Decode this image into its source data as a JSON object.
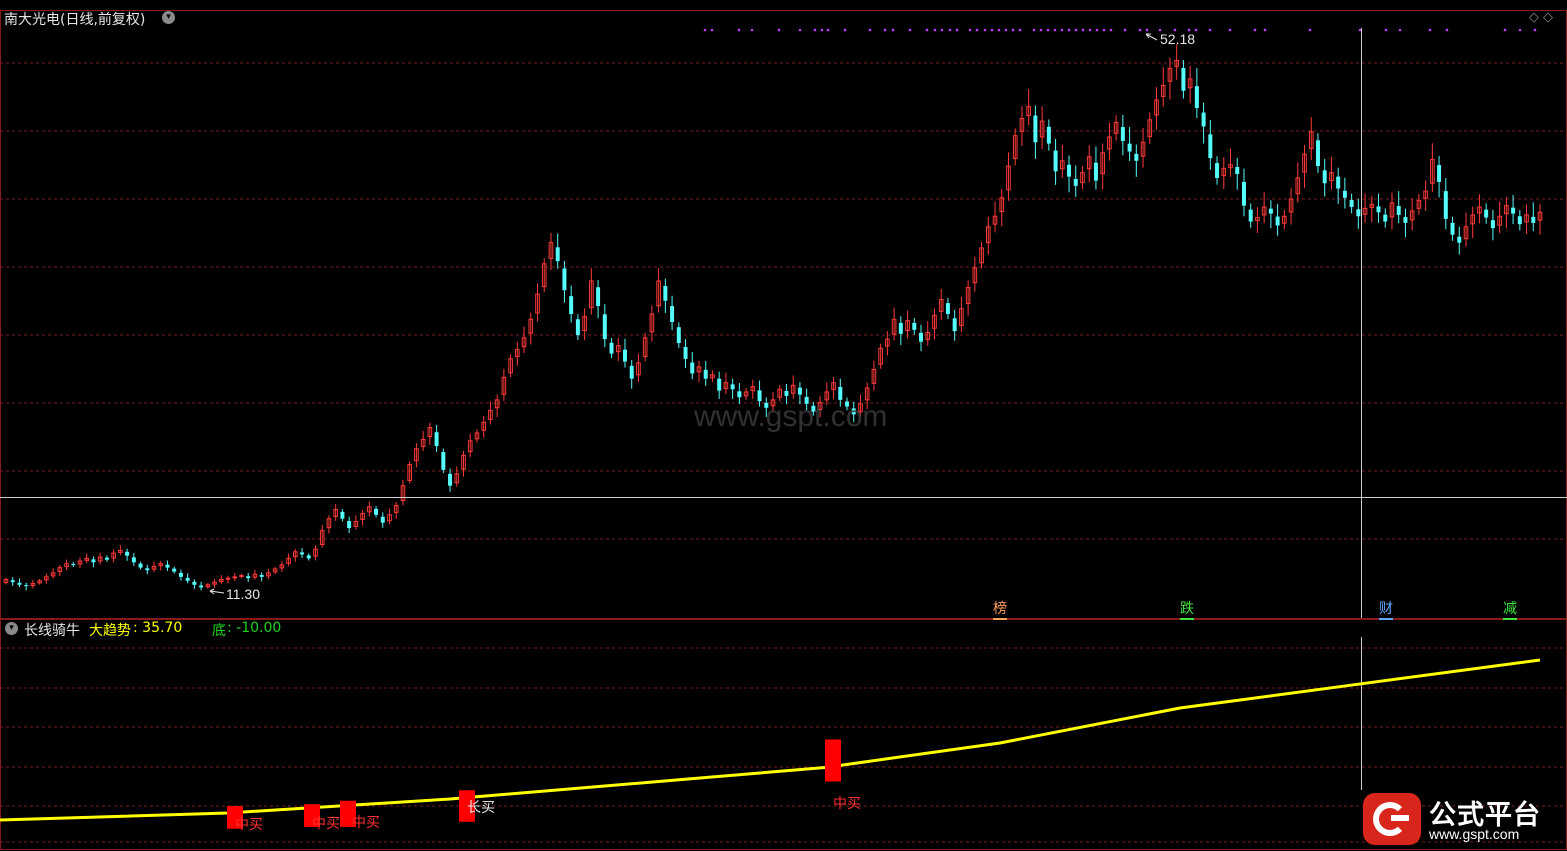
{
  "header": {
    "title": "南大光电(日线,前复权)",
    "indicator_name": "长线骑牛",
    "trend_label": "大趋势",
    "trend_value": ": 35.70",
    "bottom_label": "底",
    "bottom_value": ": -10.00"
  },
  "price_labels": {
    "high": "52.18",
    "low": "11.30"
  },
  "event_tags": [
    "榜",
    "跌",
    "财",
    "减"
  ],
  "buy_labels": [
    "中买",
    "中买",
    "中买",
    "长买",
    "中买"
  ],
  "watermark": "www.gspt.com",
  "logo": {
    "cn": "公式平台",
    "url": "www.gspt.com"
  },
  "colors": {
    "up": "#ff3a3a",
    "down": "#54fcfc",
    "trend": "#ffff00",
    "grid": "#7a1e1e",
    "buy": "#ff0000",
    "border": "#8a1a1a"
  },
  "chart_data": [
    {
      "type": "candlestick",
      "title": "南大光电(日线,前复权)",
      "series": [
        {
          "name": "南大光电",
          "close": [
            11.9,
            11.7,
            11.5,
            11.4,
            11.6,
            11.8,
            12.1,
            12.4,
            12.8,
            13.1,
            13.0,
            13.3,
            13.5,
            13.2,
            13.6,
            13.4,
            13.9,
            14.1,
            13.7,
            13.2,
            12.8,
            12.6,
            12.9,
            13.1,
            12.8,
            12.5,
            12.1,
            11.8,
            11.5,
            11.3,
            11.5,
            11.7,
            11.9,
            12.0,
            12.1,
            12.2,
            12.0,
            12.3,
            12.1,
            12.4,
            12.7,
            13.0,
            13.5,
            14.0,
            13.8,
            13.5,
            14.2,
            15.6,
            16.5,
            17.2,
            16.5,
            15.8,
            16.3,
            16.9,
            17.4,
            16.8,
            16.2,
            16.8,
            17.5,
            19.0,
            20.6,
            21.8,
            22.5,
            23.4,
            22.0,
            20.2,
            19.0,
            19.9,
            21.3,
            22.4,
            23.0,
            23.8,
            24.7,
            25.5,
            27.2,
            28.6,
            29.3,
            30.2,
            31.6,
            33.5,
            35.8,
            37.4,
            36.0,
            33.8,
            32.0,
            30.4,
            31.8,
            34.5,
            32.6,
            30.1,
            29.0,
            29.6,
            28.4,
            27.1,
            28.3,
            30.2,
            32.0,
            34.5,
            33.0,
            31.4,
            29.8,
            28.6,
            27.5,
            28.0,
            27.1,
            27.4,
            26.2,
            26.8,
            26.3,
            25.7,
            26.1,
            26.5,
            25.4,
            24.9,
            25.5,
            26.3,
            25.8,
            26.6,
            25.9,
            25.2,
            24.6,
            25.3,
            26.1,
            26.8,
            25.5,
            25.0,
            24.4,
            25.2,
            26.4,
            27.8,
            29.4,
            30.1,
            31.6,
            30.5,
            31.5,
            30.8,
            29.9,
            30.6,
            31.9,
            33.1,
            32.0,
            30.7,
            32.4,
            34.0,
            35.5,
            37.0,
            38.6,
            39.4,
            40.8,
            43.2,
            45.5,
            46.8,
            47.7,
            45.0,
            46.6,
            44.9,
            42.8,
            43.6,
            42.4,
            41.7,
            42.7,
            43.9,
            42.1,
            44.2,
            45.4,
            46.5,
            45.1,
            44.3,
            43.6,
            45.0,
            46.7,
            48.2,
            49.3,
            50.6,
            51.2,
            48.9,
            49.8,
            47.6,
            46.2,
            43.8,
            42.3,
            43.0,
            43.3,
            42.6,
            40.2,
            39.0,
            39.3,
            40.1,
            39.6,
            38.7,
            39.4,
            40.7,
            42.3,
            44.1,
            45.8,
            43.2,
            41.9,
            42.7,
            41.5,
            40.8,
            40.1,
            39.4,
            40.0,
            40.3,
            39.7,
            39.0,
            40.4,
            39.5,
            38.9,
            39.8,
            40.6,
            41.3,
            43.7,
            42.0,
            39.2,
            38.0,
            37.4,
            38.6,
            39.5,
            40.1,
            39.3,
            38.5,
            39.4,
            40.2,
            39.6,
            38.8,
            39.5,
            38.9,
            39.7
          ]
        }
      ],
      "extremes": {
        "high": 52.18,
        "low": 11.3
      },
      "ylim": [
        10.5,
        53.5
      ]
    },
    {
      "type": "line",
      "title": "长线骑牛",
      "series": [
        {
          "name": "大趋势",
          "values_anchor_x": [
            0,
            228,
            450,
            700,
            825,
            1000,
            1180,
            1350,
            1540
          ],
          "values": [
            -10.0,
            -8.0,
            -4.0,
            2.0,
            5.0,
            12.0,
            22.0,
            28.5,
            35.7
          ]
        },
        {
          "name": "底",
          "values": [
            -10.0
          ]
        }
      ],
      "signals": [
        {
          "label": "中买",
          "x": 235,
          "y_low": -12.5,
          "y_high": -6.0
        },
        {
          "label": "中买",
          "x": 312,
          "y_low": -12.0,
          "y_high": -5.5
        },
        {
          "label": "中买",
          "x": 348,
          "y_low": -12.0,
          "y_high": -4.5
        },
        {
          "label": "长买",
          "x": 467,
          "y_low": -10.5,
          "y_high": -1.5
        },
        {
          "label": "中买",
          "x": 833,
          "y_low": 1.0,
          "y_high": 13.0
        }
      ],
      "ylim": [
        -18,
        42
      ]
    }
  ]
}
